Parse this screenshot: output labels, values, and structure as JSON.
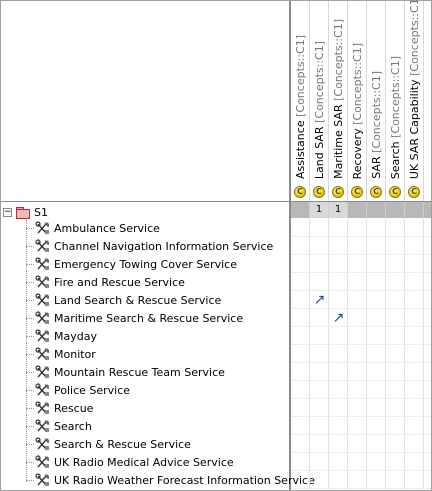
{
  "columns": [
    {
      "name": "Assistance",
      "qualifier": "[Concepts::C1]"
    },
    {
      "name": "Land SAR",
      "qualifier": "[Concepts::C1]"
    },
    {
      "name": "Maritime SAR",
      "qualifier": "[Concepts::C1]"
    },
    {
      "name": "Recovery",
      "qualifier": "[Concepts::C1]"
    },
    {
      "name": "SAR",
      "qualifier": "[Concepts::C1]"
    },
    {
      "name": "Search",
      "qualifier": "[Concepts::C1]"
    },
    {
      "name": "UK SAR Capability",
      "qualifier": "[Concepts::C1]"
    }
  ],
  "column_icon_glyph": "C",
  "column_icon_name": "capability-icon",
  "root": {
    "label": "S1",
    "toggle": "−",
    "icon": "package-icon"
  },
  "summary": [
    "",
    "1",
    "1",
    "",
    "",
    "",
    ""
  ],
  "services": [
    {
      "label": "Ambulance Service"
    },
    {
      "label": "Channel Navigation Information Service"
    },
    {
      "label": "Emergency Towing Cover Service"
    },
    {
      "label": "Fire and Rescue Service"
    },
    {
      "label": "Land Search & Rescue Service"
    },
    {
      "label": "Maritime Search & Rescue Service"
    },
    {
      "label": "Mayday"
    },
    {
      "label": "Monitor"
    },
    {
      "label": "Mountain Rescue Team Service"
    },
    {
      "label": "Police Service"
    },
    {
      "label": "Rescue"
    },
    {
      "label": "Search"
    },
    {
      "label": "Search & Rescue Service"
    },
    {
      "label": "UK Radio Medical Advice Service"
    },
    {
      "label": "UK Radio Weather Forecast Information Service"
    }
  ],
  "service_icon": "service-tools-icon",
  "relations": [
    {
      "row": 4,
      "col": 1,
      "glyph": "↗"
    },
    {
      "row": 5,
      "col": 2,
      "glyph": "↗"
    }
  ],
  "colors": {
    "accent_arrow": "#1a4aa6",
    "summary_bg": "#b8b8b8",
    "package": "#f2b8b8"
  }
}
